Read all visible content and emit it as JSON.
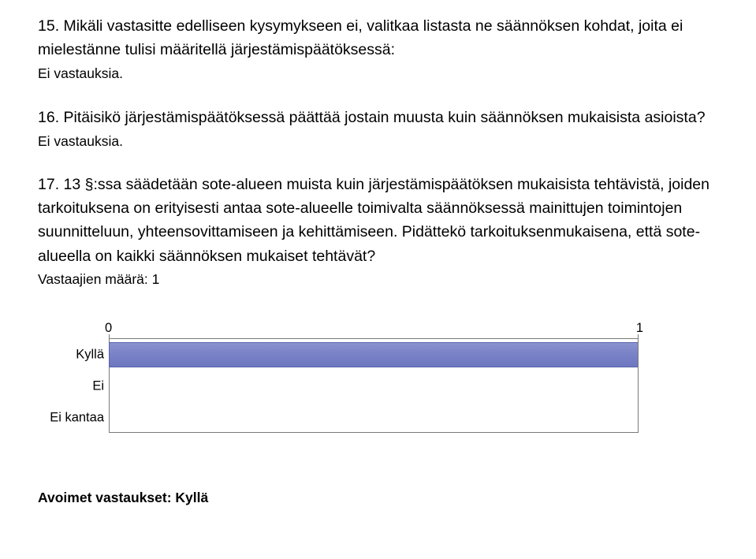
{
  "q15": {
    "text": "15. Mikäli vastasitte edelliseen kysymykseen ei, valitkaa listasta ne säännöksen kohdat, joita ei mielestänne tulisi määritellä järjestämispäätöksessä:",
    "no_answer": "Ei vastauksia."
  },
  "q16": {
    "text": "16. Pitäisikö järjestämispäätöksessä päättää jostain muusta kuin säännöksen mukaisista asioista?",
    "no_answer": "Ei vastauksia."
  },
  "q17": {
    "text": "17. 13 §:ssa säädetään sote-alueen muista kuin järjestämispäätöksen mukaisista tehtävistä, joiden tarkoituksena on erityisesti antaa sote-alueelle toimivalta säännöksessä mainittujen toimintojen suunnitteluun, yhteensovittamiseen ja kehittämiseen. Pidättekö tarkoituksenmukaisena, että sote-alueella on kaikki säännöksen mukaiset tehtävät?",
    "respondents": "Vastaajien määrä: 1"
  },
  "chart_data": {
    "type": "bar",
    "categories": [
      "Kyllä",
      "Ei",
      "Ei kantaa"
    ],
    "values": [
      1,
      0,
      0
    ],
    "xlim": [
      0,
      1
    ],
    "axis_min": "0",
    "axis_max": "1"
  },
  "open_answers_label": "Avoimet vastaukset: Kyllä"
}
